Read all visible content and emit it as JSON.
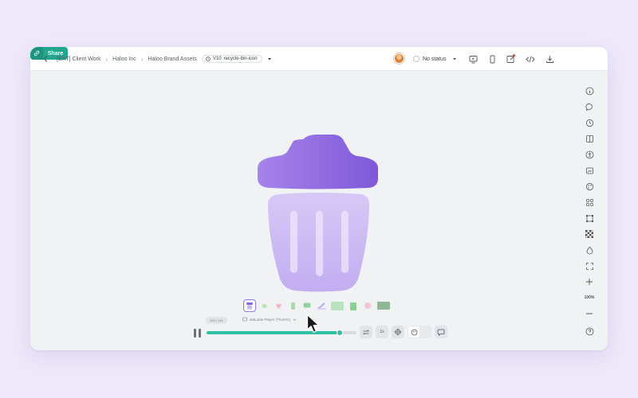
{
  "breadcrumbs": [
    "[EXT] Client Work",
    "Haloo Inc",
    "Haloo Brand Assets"
  ],
  "version": {
    "label": "V10",
    "name": "recycle-bin-icon"
  },
  "status": {
    "label": "No status"
  },
  "share": {
    "label": "Share"
  },
  "zoom": {
    "label": "100%"
  },
  "thumbnails": [
    "recycle-bin",
    "leaf",
    "heart",
    "bottle",
    "chat",
    "pen",
    "image",
    "trash",
    "face",
    "photo"
  ],
  "player": {
    "frame": "103 / 131",
    "label": "dotLottie Player (ThorVG)"
  },
  "playback": {
    "speed": "1x",
    "progress": 0.89
  },
  "colors": {
    "accent": "#22a68e",
    "progress": "#2fbfa3",
    "icon_purple": "#8c66e0",
    "icon_light": "#c9b6f4"
  }
}
